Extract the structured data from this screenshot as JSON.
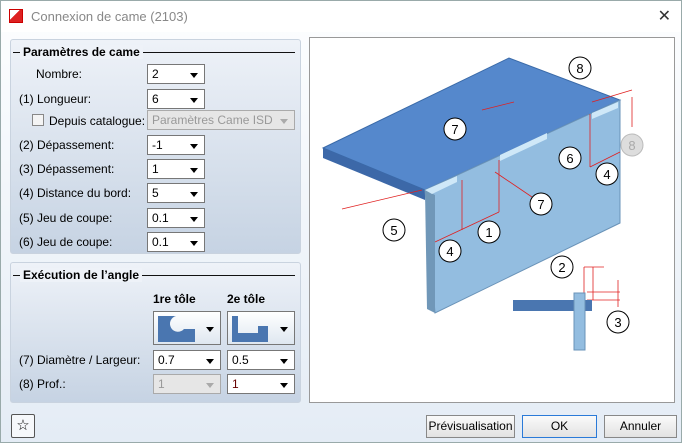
{
  "window": {
    "title": "Connexion de came (2103)",
    "close_icon": "close-icon"
  },
  "cam_params": {
    "title": "Paramètres de came",
    "rows": [
      {
        "label": "Nombre:",
        "value": "2"
      },
      {
        "label": "(1) Longueur:",
        "value": "6"
      },
      {
        "label": "Depuis catalogue:",
        "value": "Paramètres Came ISD",
        "checked": false,
        "disabled": true
      },
      {
        "label": "(2) Dépassement:",
        "value": "-1"
      },
      {
        "label": "(3) Dépassement:",
        "value": "1"
      },
      {
        "label": "(4) Distance du bord:",
        "value": "5"
      },
      {
        "label": "(5) Jeu de coupe:",
        "value": "0.1"
      },
      {
        "label": "(6) Jeu de coupe:",
        "value": "0.1"
      }
    ]
  },
  "corner": {
    "title": "Exécution de l’angle",
    "col1": "1re tôle",
    "col2": "2e tôle",
    "shape1": "round-notch-icon",
    "shape2": "rect-notch-icon",
    "diam_label": "(7) Diamètre / Largeur:",
    "diam1": "0.7",
    "diam2": "0.5",
    "depth_label": "(8) Prof.:",
    "depth1": "1",
    "depth2": "1"
  },
  "preview": {
    "callouts": [
      "8",
      "7",
      "8",
      "6",
      "4",
      "7",
      "5",
      "1",
      "4",
      "2",
      "3"
    ],
    "plate_top_color": "#5588cc",
    "plate_front_color": "#93bde0",
    "dim_color": "#e02020"
  },
  "buttons": {
    "preview": "Prévisualisation",
    "ok": "OK",
    "cancel": "Annuler",
    "favorite_icon": "star-icon"
  }
}
